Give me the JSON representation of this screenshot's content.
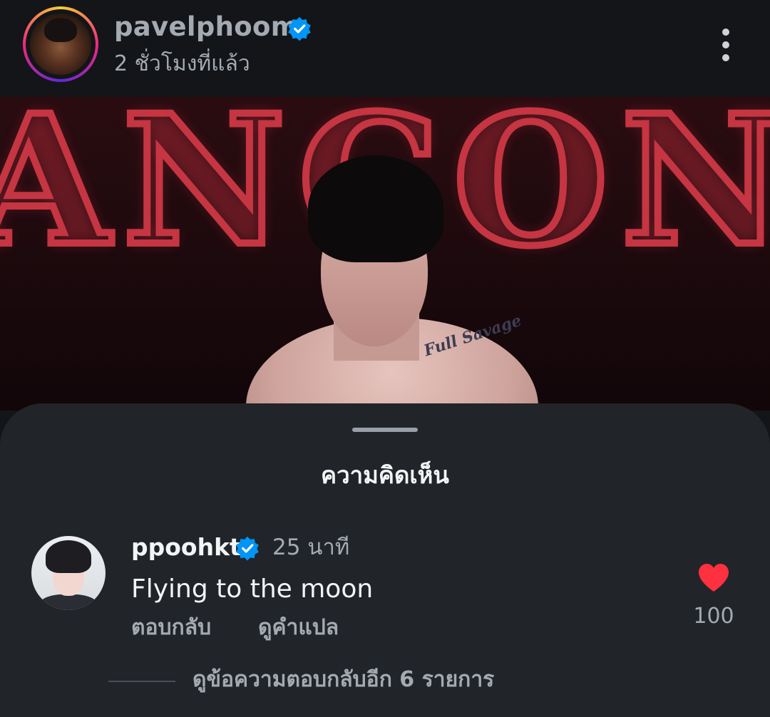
{
  "post_header": {
    "username": "pavelphoom",
    "verified": true,
    "timestamp": "2 ชั่วโมงที่แล้ว",
    "menu_icon": "more-vertical-icon"
  },
  "comments_sheet": {
    "title": "ความคิดเห็น",
    "comment": {
      "username": "ppoohkt",
      "verified": true,
      "time": "25 นาที",
      "text": "Flying to the moon",
      "reply_label": "ตอบกลับ",
      "translate_label": "ดูคำแปล",
      "like_count": "100",
      "liked": true
    },
    "view_replies_label": "ดูข้อความตอบกลับอีก 6 รายการ"
  },
  "colors": {
    "background": "#131518",
    "sheet": "#212428",
    "verified_badge": "#0095f6",
    "heart": "#ff3040"
  }
}
